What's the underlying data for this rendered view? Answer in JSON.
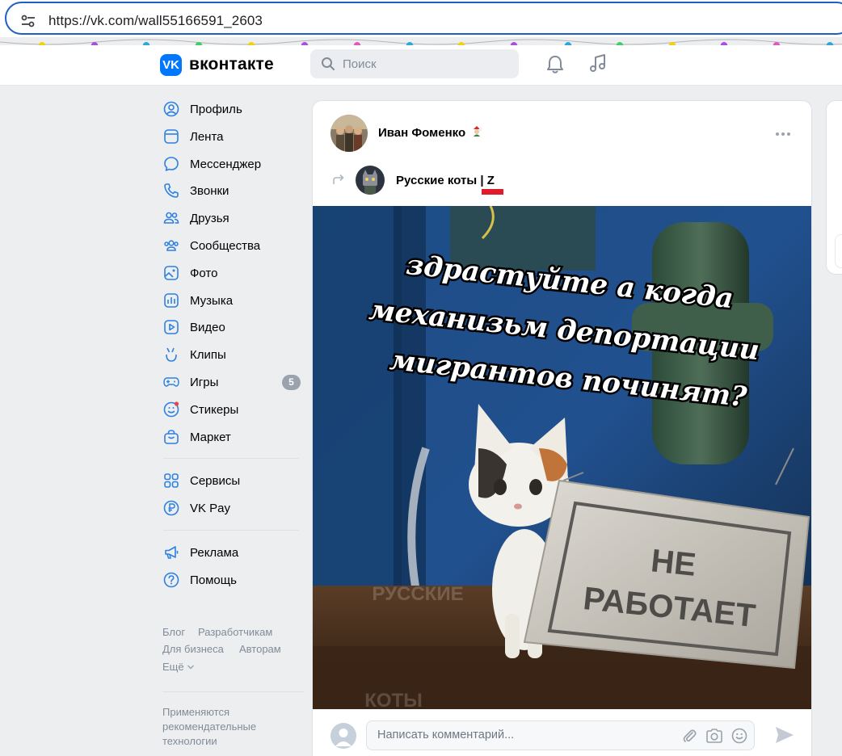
{
  "browser": {
    "url": "https://vk.com/wall55166591_2603"
  },
  "header": {
    "brand": "вконтакте",
    "logo": "VK",
    "search_placeholder": "Поиск"
  },
  "sidebar": {
    "items": [
      {
        "label": "Профиль",
        "icon": "profile-icon"
      },
      {
        "label": "Лента",
        "icon": "feed-icon"
      },
      {
        "label": "Мессенджер",
        "icon": "messenger-icon"
      },
      {
        "label": "Звонки",
        "icon": "phone-icon"
      },
      {
        "label": "Друзья",
        "icon": "friends-icon"
      },
      {
        "label": "Сообщества",
        "icon": "communities-icon"
      },
      {
        "label": "Фото",
        "icon": "photo-icon"
      },
      {
        "label": "Музыка",
        "icon": "music-icon"
      },
      {
        "label": "Видео",
        "icon": "video-icon"
      },
      {
        "label": "Клипы",
        "icon": "clips-icon"
      },
      {
        "label": "Игры",
        "icon": "games-icon",
        "badge": "5"
      },
      {
        "label": "Стикеры",
        "icon": "stickers-icon"
      },
      {
        "label": "Маркет",
        "icon": "market-icon"
      }
    ],
    "items2": [
      {
        "label": "Сервисы",
        "icon": "services-icon"
      },
      {
        "label": "VK Pay",
        "icon": "vkpay-icon"
      }
    ],
    "items3": [
      {
        "label": "Реклама",
        "icon": "ads-icon"
      },
      {
        "label": "Помощь",
        "icon": "help-icon"
      }
    ],
    "footer_links": [
      "Блог",
      "Разработчикам",
      "Для бизнеса",
      "Авторам",
      "Ещё"
    ],
    "footer_note": [
      "Применяются",
      "рекомендательные",
      "технологии"
    ]
  },
  "post": {
    "author": "Иван Фоменко",
    "group": "Русские коты",
    "group_suffix": "| Z",
    "image_caption_lines": [
      "здрастуйте а когда",
      "механизьм депортации",
      "мигрантов починят?"
    ],
    "sign_lines": [
      "НЕ",
      "РАБОТАЕТ"
    ],
    "watermark_lines": [
      "РУССКИЕ",
      "КОТЫ"
    ],
    "comment_placeholder": "Написать комментарий..."
  }
}
